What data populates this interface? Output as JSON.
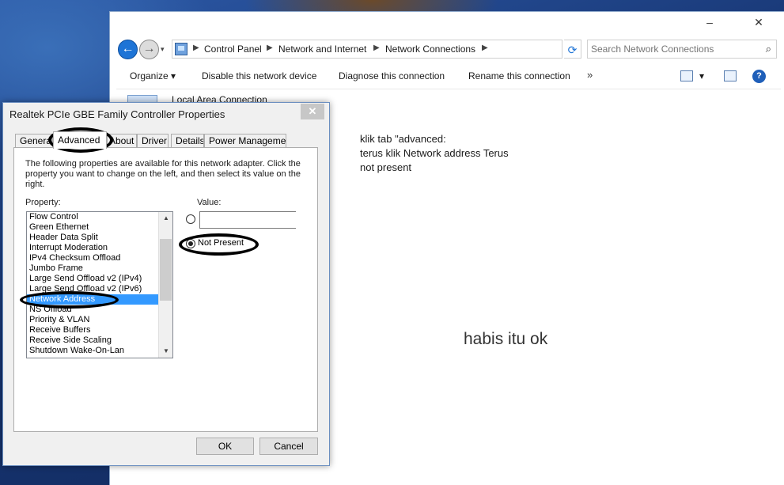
{
  "explorer": {
    "breadcrumbs": [
      "Control Panel",
      "Network and Internet",
      "Network Connections"
    ],
    "search_placeholder": "Search Network Connections",
    "commands": [
      "Organize",
      "Disable this network device",
      "Diagnose this connection",
      "Rename this connection"
    ],
    "more_glyph": "»",
    "minimize_glyph": "–",
    "close_glyph": "✕",
    "connection_item": "Local Area Connection"
  },
  "annotations": {
    "note_lines": [
      "klik tab  \"advanced:",
      "terus klik  Network address Terus",
      "not present"
    ],
    "big_note": "habis itu ok"
  },
  "dialog": {
    "title": "Realtek PCIe GBE Family Controller Properties",
    "close_glyph": "✕",
    "tabs": [
      "General",
      "Advanced",
      "About",
      "Driver",
      "Details",
      "Power Management"
    ],
    "active_tab": "Advanced",
    "description": "The following properties are available for this network adapter. Click the property you want to change on the left, and then select its value on the right.",
    "property_label": "Property:",
    "value_label": "Value:",
    "properties": [
      "Flow Control",
      "Green Ethernet",
      "Header Data Split",
      "Interrupt Moderation",
      "IPv4 Checksum Offload",
      "Jumbo Frame",
      "Large Send Offload v2 (IPv4)",
      "Large Send Offload v2 (IPv6)",
      "Network Address",
      "NS Offload",
      "Priority & VLAN",
      "Receive Buffers",
      "Receive Side Scaling",
      "Shutdown Wake-On-Lan"
    ],
    "selected_property": "Network Address",
    "value_input": "",
    "not_present_label": "Not Present",
    "not_present_checked": true,
    "ok_label": "OK",
    "cancel_label": "Cancel"
  },
  "colors": {
    "selection": "#3399ff",
    "accent": "#1e74d6"
  }
}
